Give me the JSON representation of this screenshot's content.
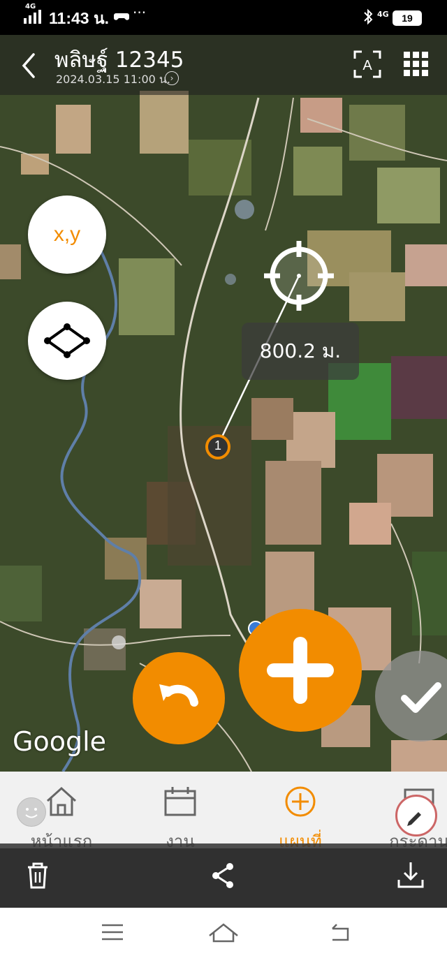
{
  "status_bar": {
    "network_left": "4G",
    "time": "11:43 น.",
    "overflow": "···",
    "network_right": "4G",
    "battery": "19"
  },
  "header": {
    "title": "พลิษฐ์ 12345",
    "subtitle": "2024.03.15 11:00 น."
  },
  "map": {
    "xy_label": "x,y",
    "distance": "800.2 ม.",
    "marker_label": "1",
    "attribution": "Google"
  },
  "nav": {
    "items": [
      {
        "label": "หน้าแรก",
        "icon": "home-icon"
      },
      {
        "label": "งาน",
        "icon": "calendar-icon"
      },
      {
        "label": "แผนที่",
        "icon": "add-circle-icon",
        "active": true
      },
      {
        "label": "กระดาน",
        "icon": "board-icon"
      }
    ]
  },
  "colors": {
    "accent": "#f28c00",
    "inactive": "#666666"
  }
}
